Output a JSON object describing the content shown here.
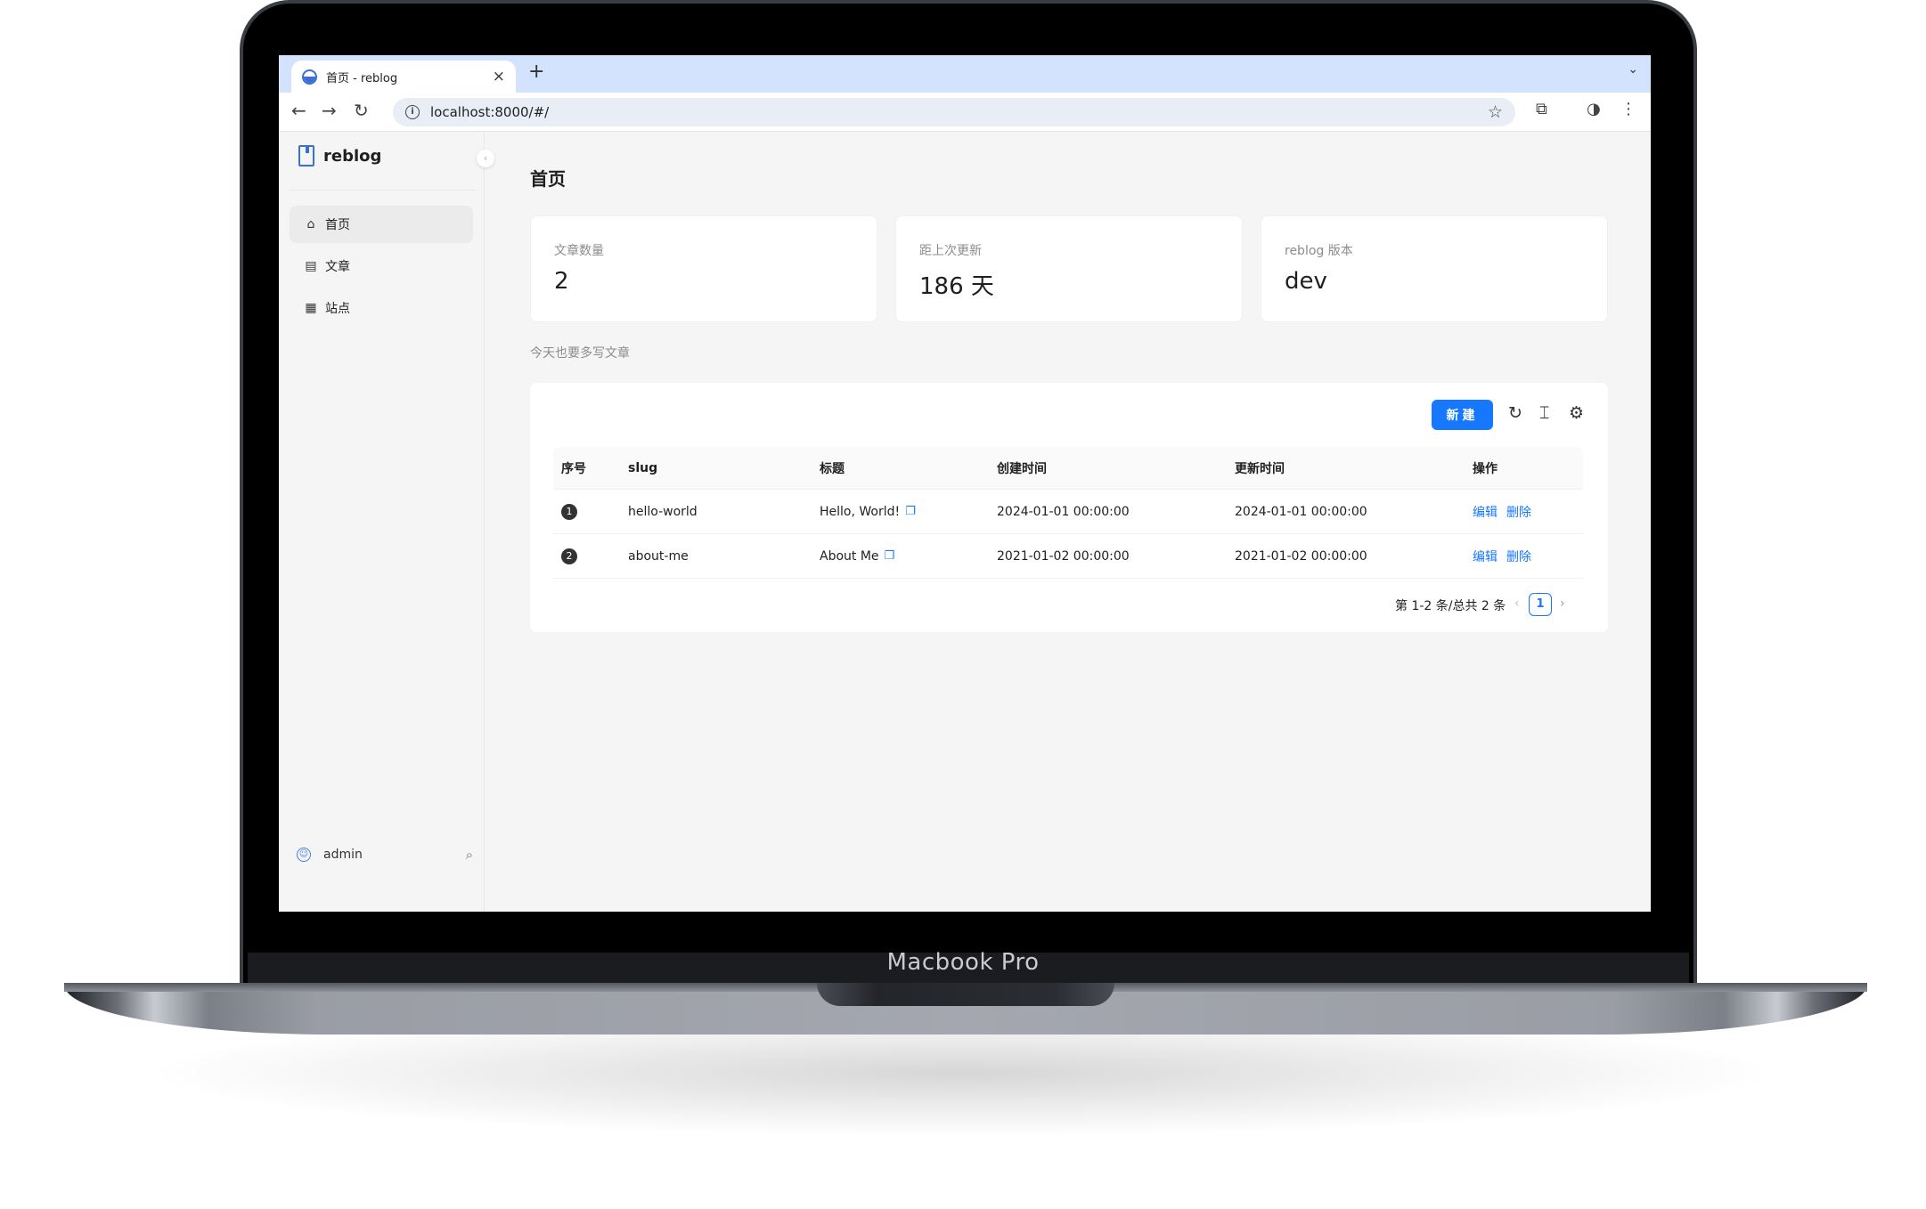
{
  "device": {
    "label": "Macbook Pro"
  },
  "browser": {
    "tab_title": "首页 - reblog",
    "tab_close": "×",
    "new_tab": "+",
    "tab_dropdown": "⌄",
    "url": "localhost:8000/#/",
    "info_glyph": "i",
    "back": "←",
    "forward": "→",
    "reload": "↻",
    "star": "☆",
    "extensions": "⧉",
    "profile": "◑",
    "menu": "⋮"
  },
  "sidebar": {
    "app_name": "reblog",
    "collapse_glyph": "‹",
    "items": [
      {
        "label": "首页",
        "icon": "home-icon",
        "glyph": "⌂"
      },
      {
        "label": "文章",
        "icon": "book-icon",
        "glyph": "▤"
      },
      {
        "label": "站点",
        "icon": "apps-icon",
        "glyph": "▦"
      }
    ],
    "user": "admin",
    "avatar_glyph": "☺",
    "search_glyph": "⌕"
  },
  "main": {
    "page_title": "首页",
    "stats": [
      {
        "label": "文章数量",
        "value": "2"
      },
      {
        "label": "距上次更新",
        "value": "186 天"
      },
      {
        "label": "reblog 版本",
        "value": "dev"
      }
    ],
    "motto": "今天也要多写文章",
    "toolbar": {
      "new_label": "新建",
      "reload_glyph": "↻",
      "density_glyph": "⌶",
      "settings_glyph": "⚙"
    },
    "table": {
      "columns": [
        "序号",
        "slug",
        "标题",
        "创建时间",
        "更新时间",
        "操作"
      ],
      "rows": [
        {
          "index": "1",
          "slug": "hello-world",
          "title": "Hello, World!",
          "created": "2024-01-01 00:00:00",
          "updated": "2024-01-01 00:00:00",
          "edit": "编辑",
          "delete": "删除"
        },
        {
          "index": "2",
          "slug": "about-me",
          "title": "About Me",
          "created": "2021-01-02 00:00:00",
          "updated": "2021-01-02 00:00:00",
          "edit": "编辑",
          "delete": "删除"
        }
      ],
      "copy_glyph": "❐"
    },
    "pagination": {
      "total_text": "第 1-2 条/总共 2 条",
      "prev": "‹",
      "current_page": "1",
      "next": "›"
    }
  },
  "colors": {
    "primary": "#1677ff",
    "logo": "#3a6fd8",
    "tabstrip": "#d3e3fd"
  }
}
